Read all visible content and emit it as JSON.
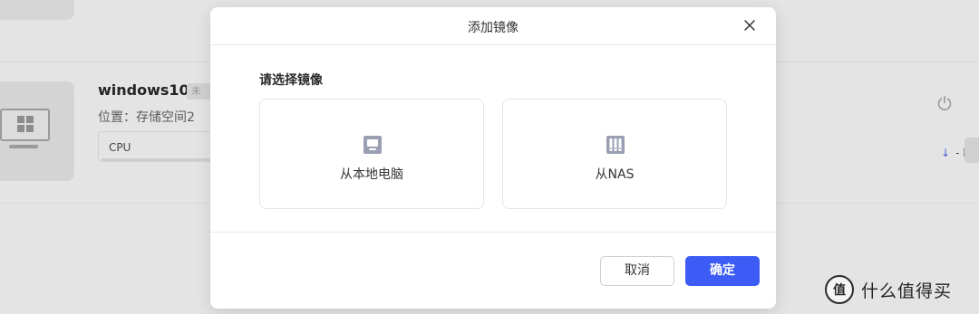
{
  "background": {
    "vm": {
      "name": "windows10",
      "status": "未",
      "location": "位置：存储空间2",
      "cpu_label": "CPU",
      "net_rate": "- KB"
    }
  },
  "modal": {
    "title": "添加镜像",
    "section_title": "请选择镜像",
    "options": [
      {
        "label": "从本地电脑",
        "icon": "computer-icon"
      },
      {
        "label": "从NAS",
        "icon": "nas-icon"
      }
    ],
    "cancel_label": "取消",
    "confirm_label": "确定"
  },
  "watermark": {
    "text": "什么值得买"
  },
  "colors": {
    "accent": "#3d5cf5",
    "icon_gray": "#9a9fb3",
    "overlay": "#e3e3e3"
  }
}
